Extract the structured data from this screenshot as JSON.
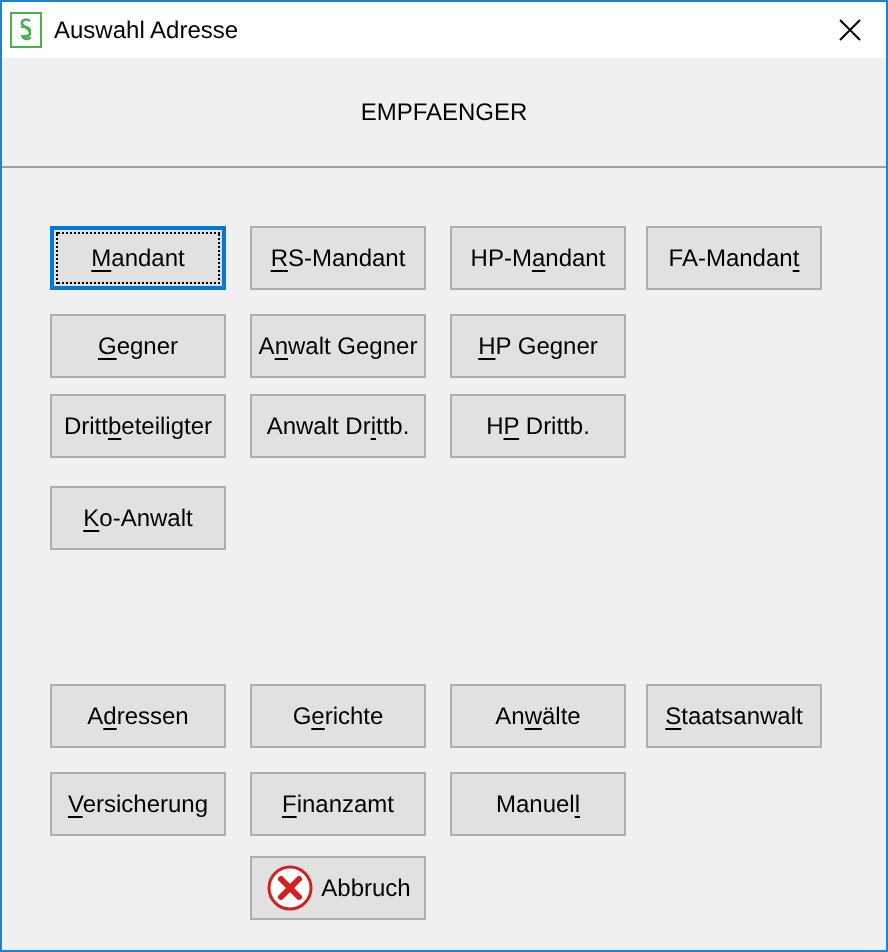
{
  "window": {
    "title": "Auswahl Adresse"
  },
  "header": "EMPFAENGER",
  "groups": [
    {
      "rows": [
        [
          {
            "kind": "button",
            "key": "M",
            "post": "andant",
            "focused": true
          },
          {
            "kind": "button",
            "key": "R",
            "post": "S-Mandant",
            "focused": false
          },
          {
            "kind": "button",
            "pre": "HP-M",
            "key": "a",
            "post": "ndant",
            "focused": false
          },
          {
            "kind": "button",
            "pre": "FA-Mandan",
            "key": "t",
            "focused": false
          }
        ],
        [
          {
            "kind": "button",
            "key": "G",
            "post": "egner",
            "focused": false
          },
          {
            "kind": "button",
            "pre": "A",
            "key": "n",
            "post": "walt Gegner",
            "focused": false
          },
          {
            "kind": "button",
            "key": "H",
            "post": "P Gegner",
            "focused": false
          }
        ],
        [
          {
            "kind": "button",
            "pre": "Dritt",
            "key": "b",
            "post": "eteiligter",
            "focused": false
          },
          {
            "kind": "button",
            "pre": "Anwalt Dr",
            "key": "i",
            "post": "ttb.",
            "focused": false
          },
          {
            "kind": "button",
            "pre": "H",
            "key": "P",
            "post": " Drittb.",
            "focused": false
          }
        ],
        [
          {
            "kind": "button",
            "key": "K",
            "post": "o-Anwalt",
            "focused": false
          }
        ]
      ]
    },
    {
      "rows": [
        [
          {
            "kind": "button",
            "pre": "A",
            "key": "d",
            "post": "ressen",
            "focused": false
          },
          {
            "kind": "button",
            "pre": "G",
            "key": "e",
            "post": "richte",
            "focused": false
          },
          {
            "kind": "button",
            "pre": "An",
            "key": "w",
            "post": "älte",
            "focused": false
          },
          {
            "kind": "button",
            "key": "S",
            "post": "taatsanwalt",
            "focused": false
          }
        ],
        [
          {
            "kind": "button",
            "key": "V",
            "post": "ersicherung",
            "focused": false
          },
          {
            "kind": "button",
            "key": "F",
            "post": "inanzamt",
            "focused": false
          },
          {
            "kind": "button",
            "pre": "Manuel",
            "key": "l",
            "focused": false
          }
        ],
        [
          {
            "kind": "spacer"
          },
          {
            "kind": "cancel",
            "pre": "Abbruch",
            "focused": false
          }
        ]
      ]
    }
  ]
}
